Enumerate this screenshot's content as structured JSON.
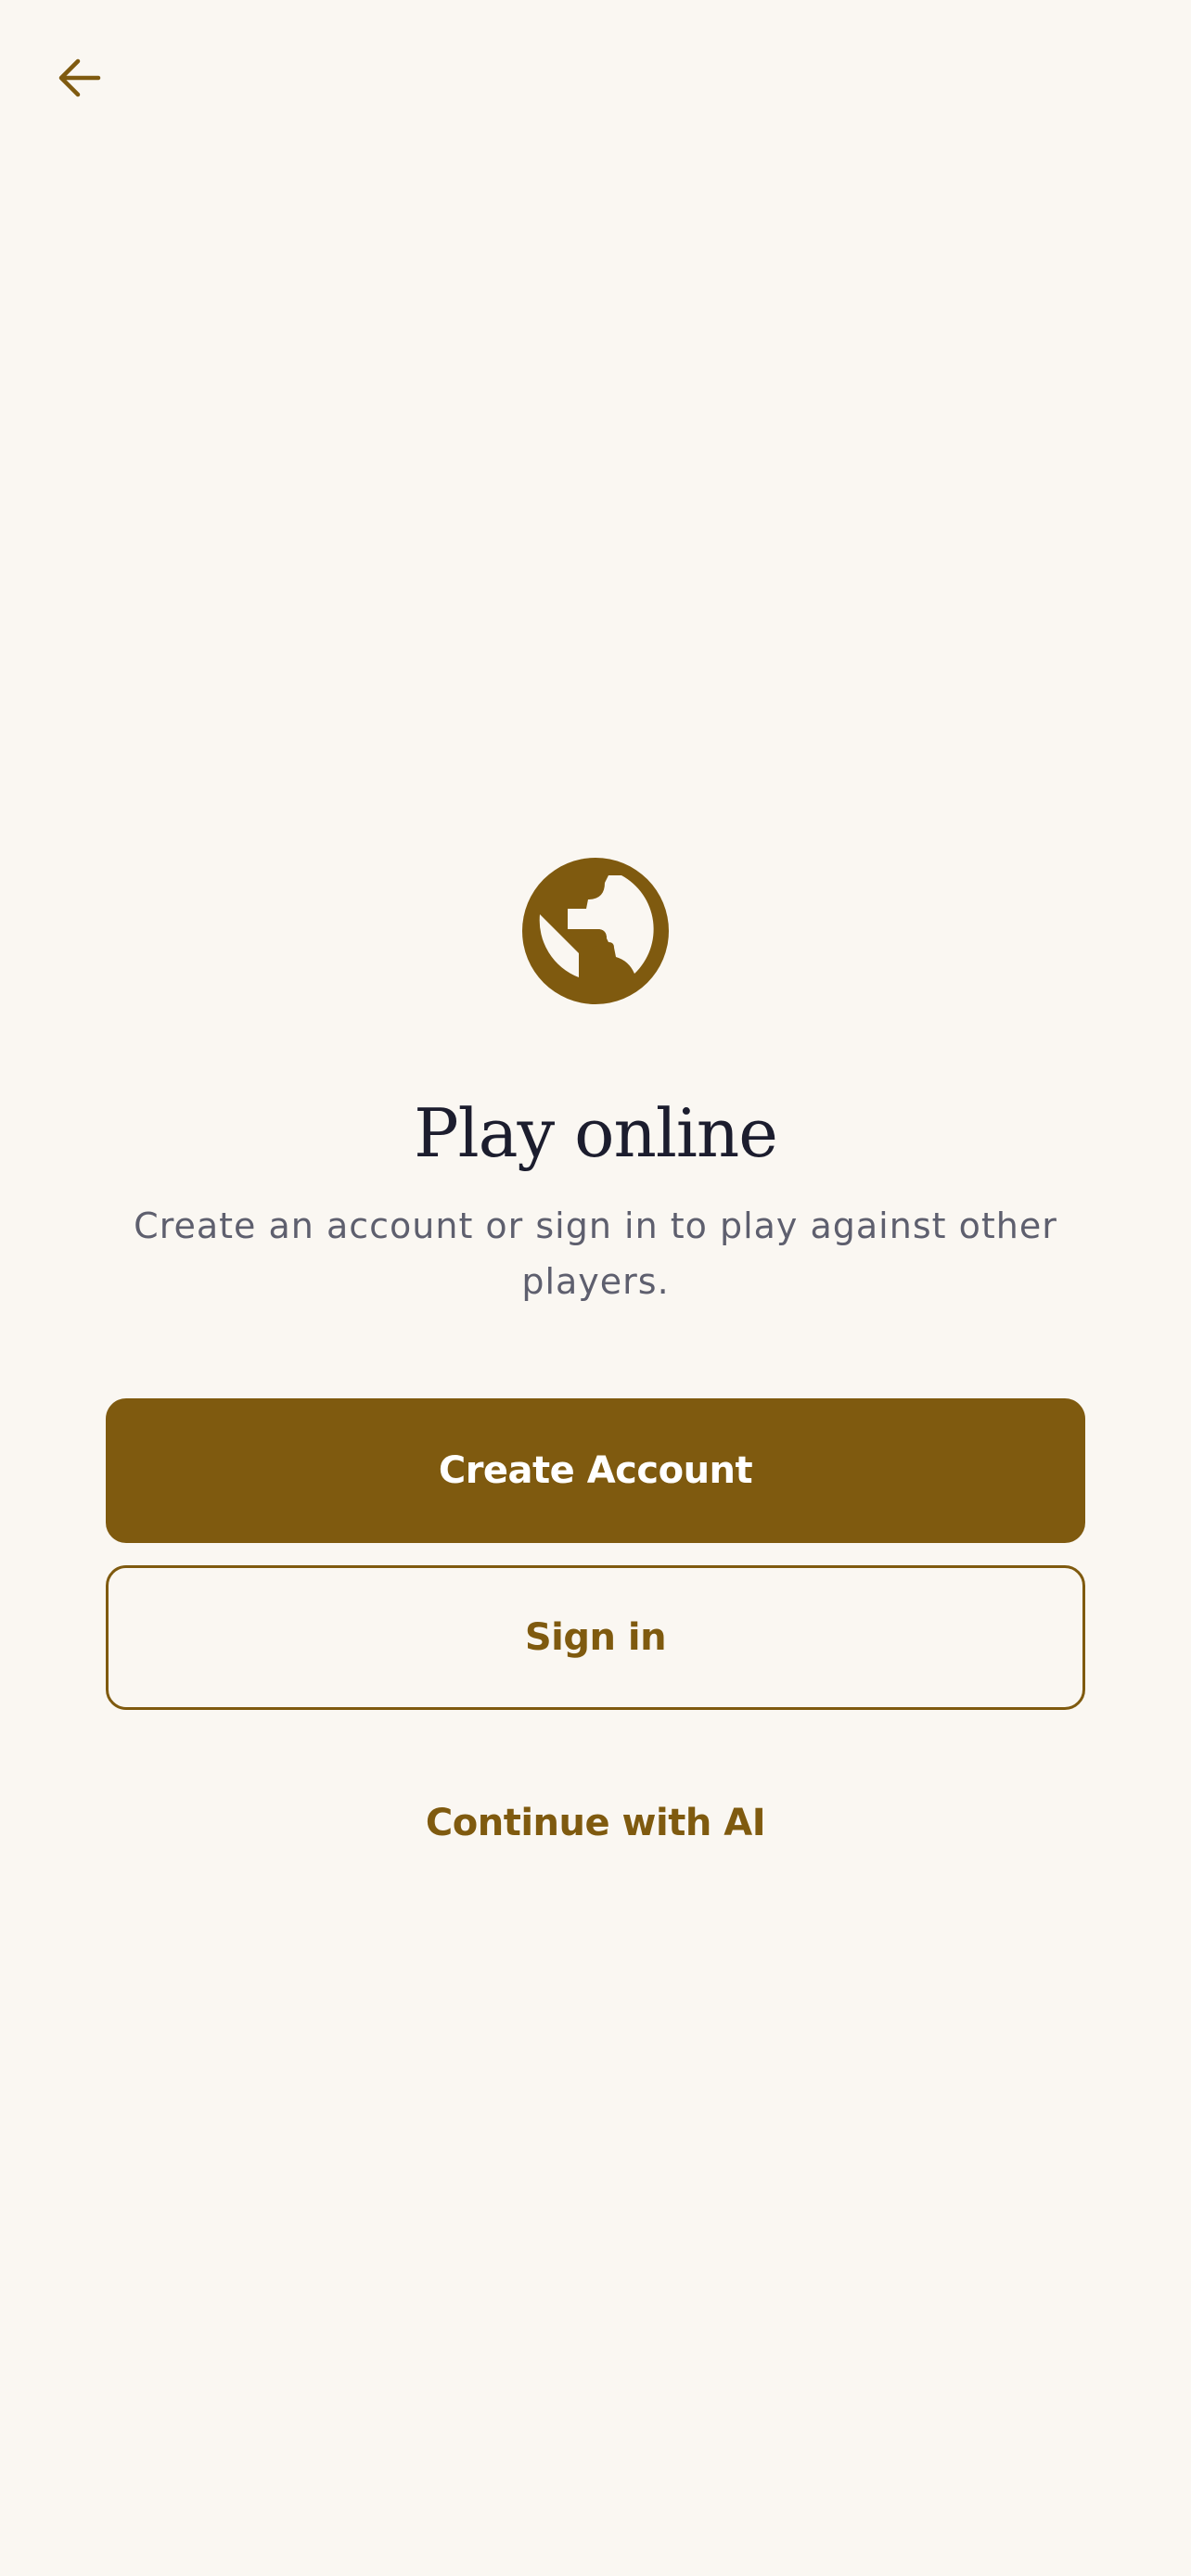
{
  "header": {
    "back_icon": "arrow-left-icon"
  },
  "hero": {
    "icon": "globe-icon",
    "title": "Play online",
    "subtitle": "Create an account or sign in to play against other players."
  },
  "actions": {
    "create_account_label": "Create Account",
    "sign_in_label": "Sign in",
    "continue_ai_label": "Continue with AI"
  },
  "colors": {
    "background": "#faf7f2",
    "accent": "#7f5a0f",
    "title": "#1c1d2e",
    "subtitle": "#5e5f6e"
  }
}
